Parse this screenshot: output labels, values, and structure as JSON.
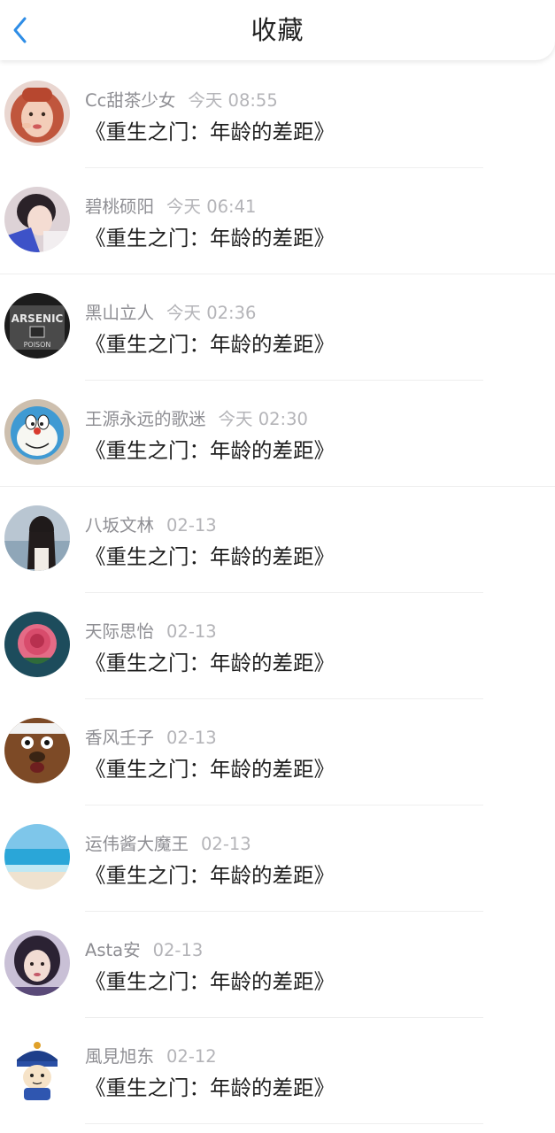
{
  "header": {
    "title": "收藏",
    "back_icon": "chevron-left-icon",
    "accent": "#2e8de6"
  },
  "items": [
    {
      "name": "Cc甜茶少女",
      "time": "今天 08:55",
      "text": "《重生之门：年龄的差距》",
      "avatar": "red-haired-girl-avatar"
    },
    {
      "name": "碧桃硕阳",
      "time": "今天 06:41",
      "text": "《重生之门：年龄的差距》",
      "avatar": "girl-portrait-avatar"
    },
    {
      "name": "黑山立人",
      "time": "今天 02:36",
      "text": "《重生之门：年龄的差距》",
      "avatar": "arsenic-poison-avatar"
    },
    {
      "name": "王源永远的歌迷",
      "time": "今天 02:30",
      "text": "《重生之门：年龄的差距》",
      "avatar": "doraemon-avatar"
    },
    {
      "name": "八坂文林",
      "time": "02-13",
      "text": "《重生之门：年龄的差距》",
      "avatar": "girl-seaside-avatar"
    },
    {
      "name": "天际思怡",
      "time": "02-13",
      "text": "《重生之门：年龄的差距》",
      "avatar": "rose-avatar"
    },
    {
      "name": "香风壬子",
      "time": "02-13",
      "text": "《重生之门：年龄的差距》",
      "avatar": "brown-bear-avatar"
    },
    {
      "name": "运伟酱大魔王",
      "time": "02-13",
      "text": "《重生之门：年龄的差距》",
      "avatar": "beach-avatar"
    },
    {
      "name": "Asta安",
      "time": "02-13",
      "text": "《重生之门：年龄的差距》",
      "avatar": "girl-dark-hair-avatar"
    },
    {
      "name": "風見旭东",
      "time": "02-12",
      "text": "《重生之门：年龄的差距》",
      "avatar": "qing-official-cartoon-avatar"
    }
  ]
}
